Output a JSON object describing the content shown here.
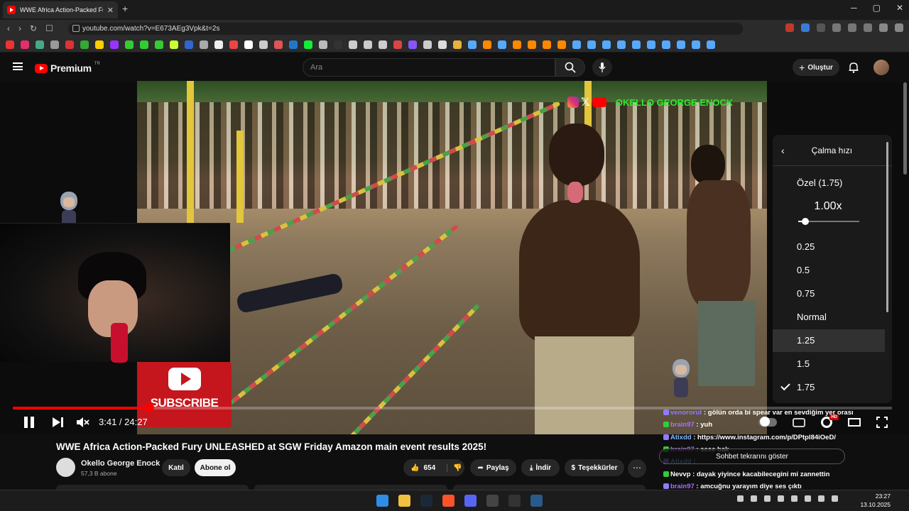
{
  "browser": {
    "tab_title": "WWE Africa Action-Packed Fury",
    "url": "youtube.com/watch?v=E673AEg3Vpk&t=2s"
  },
  "header": {
    "logo_text": "Premium",
    "logo_region": "TR",
    "search_placeholder": "Ara",
    "create_label": "Oluştur"
  },
  "video": {
    "watermark_name": "OKELLO GEORGE ENOCK",
    "subscribe_overlay": "SUBSCRIBE",
    "current_time": "3:41",
    "duration": "24:27",
    "time_display": "3:41 / 24:27",
    "progress_fraction": 0.15,
    "hd_badge": "HD"
  },
  "speed_menu": {
    "title": "Çalma hızı",
    "custom_label": "Özel (1.75)",
    "current_value": "1.00x",
    "slider_fraction": 0.1,
    "options": [
      "0.25",
      "0.5",
      "0.75",
      "Normal",
      "1.25",
      "1.5",
      "1.75"
    ],
    "highlighted": "1.25",
    "checked": "1.75"
  },
  "chat": {
    "replay_label": "Sohbet tekrarını göster",
    "lines": [
      {
        "user": "venororut",
        "text": " : gölün orda bi spear var en sevdiğim yer orası",
        "color": "#8e7bff"
      },
      {
        "user": "brain97",
        "text": " : yuh",
        "color": "#a970ff"
      },
      {
        "user": "Atixdd",
        "text": " : https://www.instagram.com/p/DPtpl84iOeD/",
        "color": "#7fb8ff"
      },
      {
        "user": "brain97",
        "text": " : sese bak",
        "color": "#a970ff"
      },
      {
        "user": "Atixdd",
        "text": " : ",
        "color": "#7fb8ff"
      },
      {
        "user": "Nevvp",
        "text": " : dayak yiyince kacabilecegini mi zannettin",
        "color": "#ffffff"
      },
      {
        "user": "brain97",
        "text": " : amcuğnu yarayım diye ses çıktı",
        "color": "#a970ff"
      }
    ]
  },
  "below": {
    "title": "WWE Africa Action-Packed Fury UNLEASHED at SGW Friday Amazon main event results 2025!",
    "channel_name": "Okello George Enock",
    "channel_subs": "57,3 B abone",
    "join_label": "Katıl",
    "subscribe_label": "Abone ol",
    "like_count": "654",
    "share_label": "Paylaş",
    "download_label": "İndir",
    "thanks_label": "Teşekkürler",
    "more_label": "⋯"
  },
  "taskbar": {
    "time": "23:27",
    "date": "13.10.2025"
  }
}
